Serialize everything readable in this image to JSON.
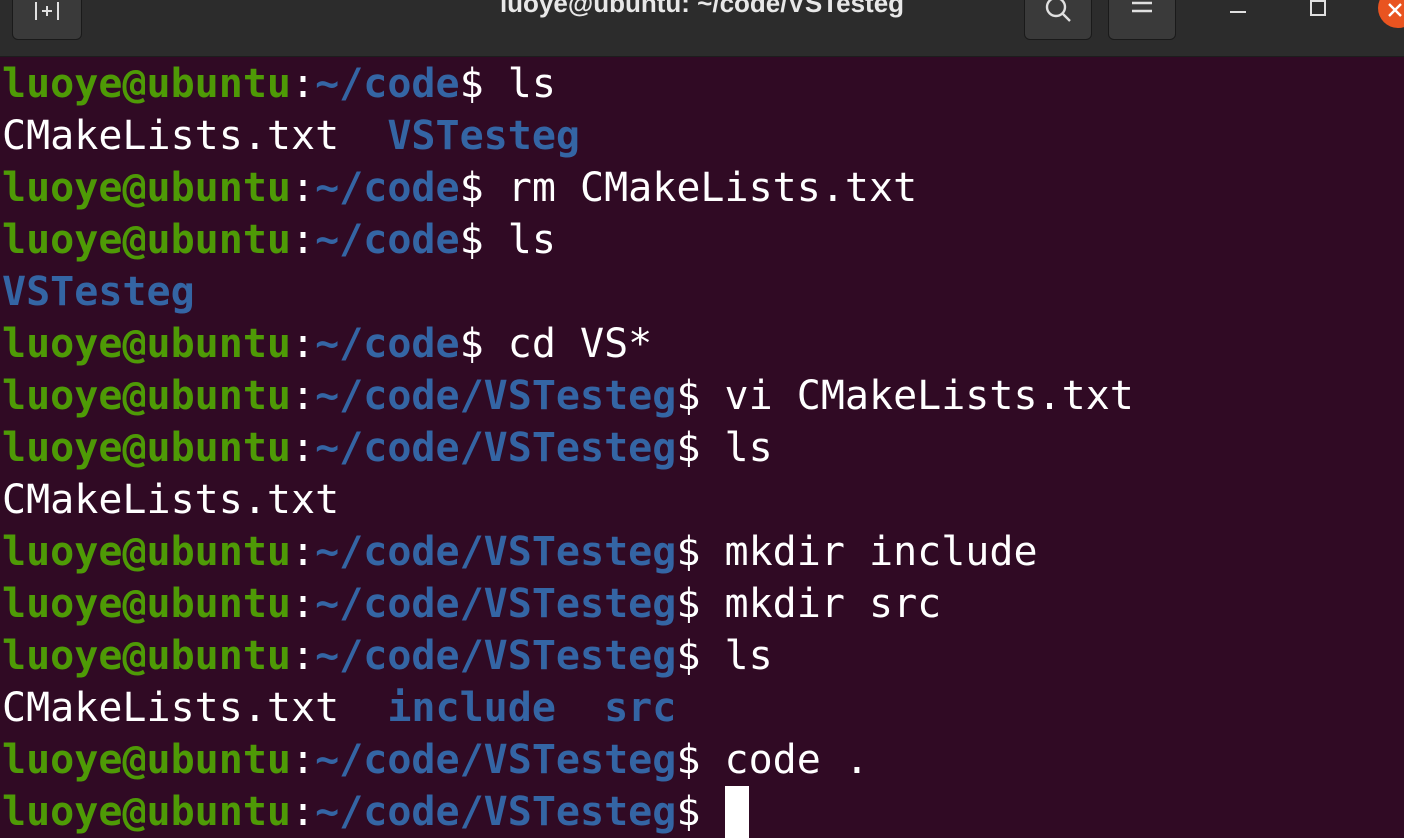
{
  "window": {
    "title": "luoye@ubuntu: ~/code/VSTesteg"
  },
  "titlebar": {
    "new_tab_icon": "new-tab-icon",
    "search_icon": "search-icon",
    "menu_icon": "hamburger-menu-icon",
    "minimize_icon": "minimize-icon",
    "maximize_icon": "maximize-icon",
    "close_icon": "close-icon"
  },
  "colors": {
    "background": "#300a24",
    "user_host": "#4e9a06",
    "path": "#3465a4",
    "text": "#ffffff",
    "close_button": "#e95420"
  },
  "terminal": {
    "lines": [
      {
        "type": "prompt",
        "user": "luoye@ubuntu",
        "colon": ":",
        "path": "~/code",
        "dollar": "$",
        "cmd": " ls"
      },
      {
        "type": "output",
        "parts": [
          {
            "text": "CMakeLists.txt",
            "kind": "file"
          },
          {
            "text": "  ",
            "kind": "file"
          },
          {
            "text": "VSTesteg",
            "kind": "dir"
          }
        ]
      },
      {
        "type": "prompt",
        "user": "luoye@ubuntu",
        "colon": ":",
        "path": "~/code",
        "dollar": "$",
        "cmd": " rm CMakeLists.txt"
      },
      {
        "type": "prompt",
        "user": "luoye@ubuntu",
        "colon": ":",
        "path": "~/code",
        "dollar": "$",
        "cmd": " ls"
      },
      {
        "type": "output",
        "parts": [
          {
            "text": "VSTesteg",
            "kind": "dir"
          }
        ]
      },
      {
        "type": "prompt",
        "user": "luoye@ubuntu",
        "colon": ":",
        "path": "~/code",
        "dollar": "$",
        "cmd": " cd VS*"
      },
      {
        "type": "prompt",
        "user": "luoye@ubuntu",
        "colon": ":",
        "path": "~/code/VSTesteg",
        "dollar": "$",
        "cmd": " vi CMakeLists.txt"
      },
      {
        "type": "prompt",
        "user": "luoye@ubuntu",
        "colon": ":",
        "path": "~/code/VSTesteg",
        "dollar": "$",
        "cmd": " ls"
      },
      {
        "type": "output",
        "parts": [
          {
            "text": "CMakeLists.txt",
            "kind": "file"
          }
        ]
      },
      {
        "type": "prompt",
        "user": "luoye@ubuntu",
        "colon": ":",
        "path": "~/code/VSTesteg",
        "dollar": "$",
        "cmd": " mkdir include"
      },
      {
        "type": "prompt",
        "user": "luoye@ubuntu",
        "colon": ":",
        "path": "~/code/VSTesteg",
        "dollar": "$",
        "cmd": " mkdir src"
      },
      {
        "type": "prompt",
        "user": "luoye@ubuntu",
        "colon": ":",
        "path": "~/code/VSTesteg",
        "dollar": "$",
        "cmd": " ls"
      },
      {
        "type": "output",
        "parts": [
          {
            "text": "CMakeLists.txt",
            "kind": "file"
          },
          {
            "text": "  ",
            "kind": "file"
          },
          {
            "text": "include",
            "kind": "dir"
          },
          {
            "text": "  ",
            "kind": "file"
          },
          {
            "text": "src",
            "kind": "dir"
          }
        ]
      },
      {
        "type": "prompt",
        "user": "luoye@ubuntu",
        "colon": ":",
        "path": "~/code/VSTesteg",
        "dollar": "$",
        "cmd": " code ."
      },
      {
        "type": "prompt",
        "user": "luoye@ubuntu",
        "colon": ":",
        "path": "~/code/VSTesteg",
        "dollar": "$",
        "cmd": " ",
        "cursor": true
      }
    ]
  }
}
